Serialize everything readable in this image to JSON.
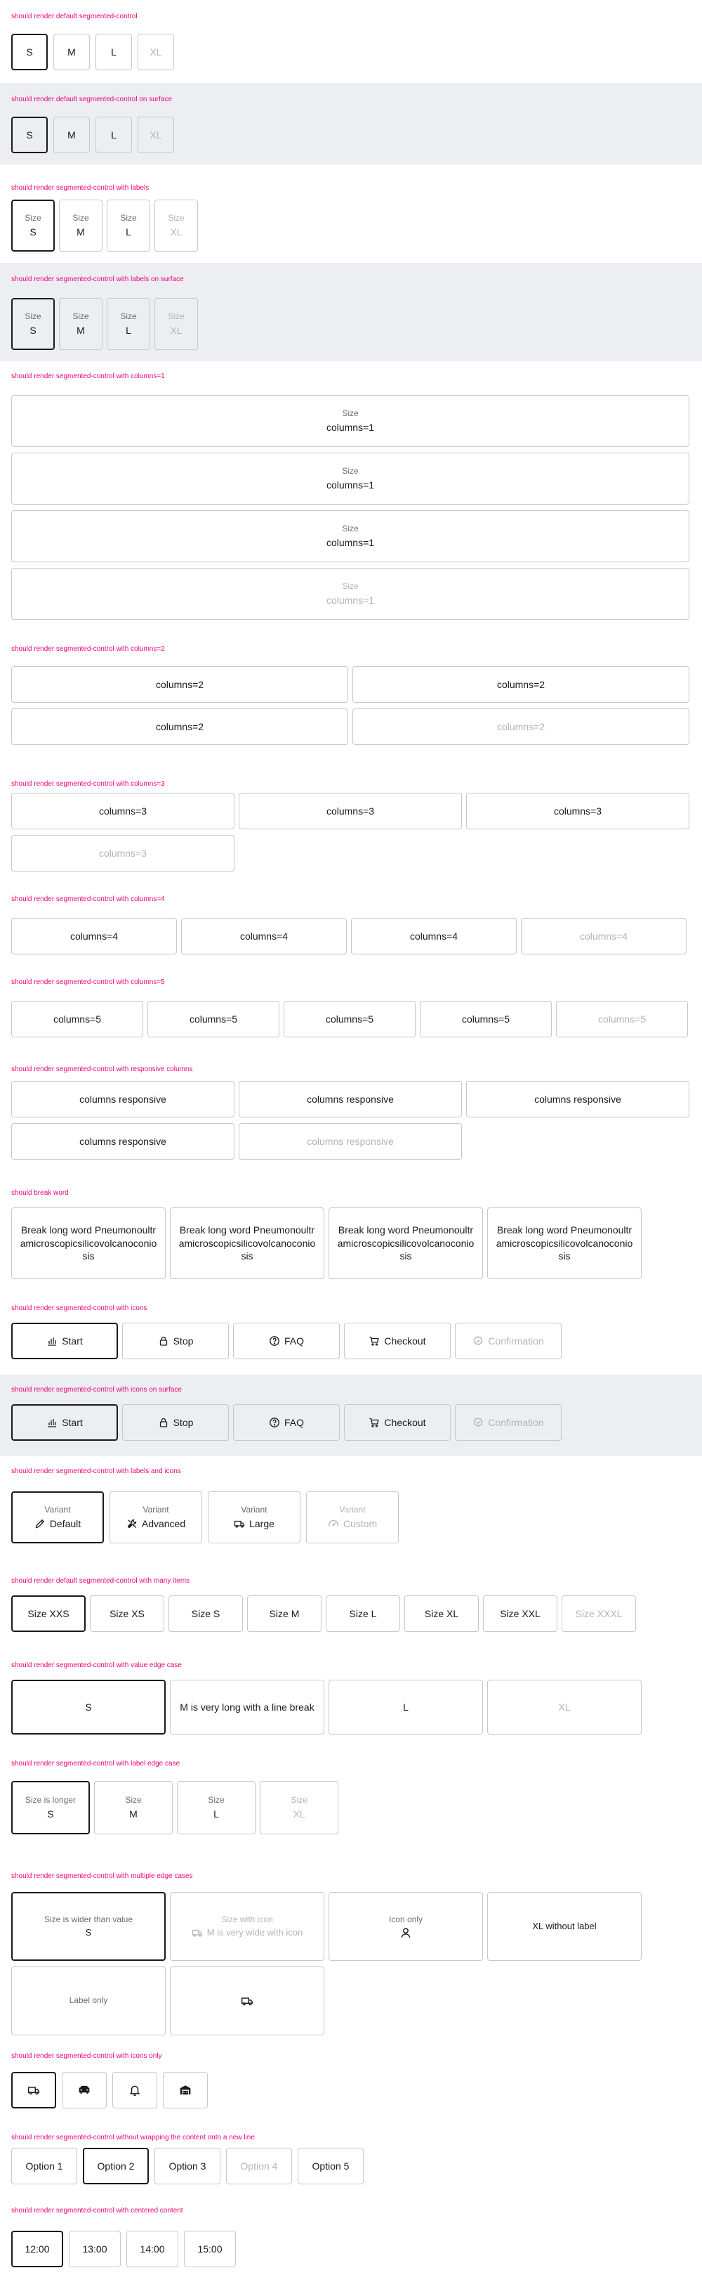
{
  "sections": [
    {
      "caption": "should render default segmented-control",
      "items": [
        "S",
        "M",
        "L",
        "XL"
      ]
    },
    {
      "caption": "should render default segmented-control on surface",
      "items": [
        "S",
        "M",
        "L",
        "XL"
      ]
    },
    {
      "caption": "should render segmented-control with labels",
      "label": "Size",
      "items": [
        "S",
        "M",
        "L",
        "XL"
      ]
    },
    {
      "caption": "should render segmented-control with labels on surface",
      "label": "Size",
      "items": [
        "S",
        "M",
        "L",
        "XL"
      ]
    },
    {
      "caption": "should render segmented-control with columns=1",
      "label": "Size",
      "value": "columns=1"
    },
    {
      "caption": "should render segmented-control with columns=2",
      "value": "columns=2"
    },
    {
      "caption": "should render segmented-control with columns=3",
      "value": "columns=3"
    },
    {
      "caption": "should render segmented-control with columns=4",
      "value": "columns=4"
    },
    {
      "caption": "should render segmented-control with columns=5",
      "value": "columns=5"
    },
    {
      "caption": "should render segmented-control with responsive columns",
      "value": "columns responsive"
    },
    {
      "caption": "should break word",
      "value": "Break long word Pneumonoultramicroscopicsilicovolcanoconiosis"
    },
    {
      "caption": "should render segmented-control with icons",
      "items": [
        "Start",
        "Stop",
        "FAQ",
        "Checkout",
        "Confirmation"
      ]
    },
    {
      "caption": "should render segmented-control with icons on surface",
      "items": [
        "Start",
        "Stop",
        "FAQ",
        "Checkout",
        "Confirmation"
      ]
    },
    {
      "caption": "should render segmented-control with labels and icons",
      "label": "Variant",
      "items": [
        "Default",
        "Advanced",
        "Large",
        "Custom"
      ]
    },
    {
      "caption": "should render default segmented-control with many items",
      "items": [
        "Size XXS",
        "Size XS",
        "Size S",
        "Size M",
        "Size L",
        "Size XL",
        "Size XXL",
        "Size XXXL"
      ]
    },
    {
      "caption": "should render segmented-control with value edge case",
      "items": [
        "S",
        "M is very long with a line break",
        "L",
        "XL"
      ]
    },
    {
      "caption": "should render segmented-control with label edge case",
      "labels": [
        "Size is longer",
        "Size",
        "Size",
        "Size"
      ],
      "items": [
        "S",
        "M",
        "L",
        "XL"
      ]
    },
    {
      "caption": "should render segmented-control with multiple edge cases",
      "items": [
        {
          "label": "Size is wider than value",
          "value": "S"
        },
        {
          "label": "Size with icon",
          "value": "M is very wide with icon"
        },
        {
          "label": "Icon only",
          "value": ""
        },
        {
          "label": "",
          "value": "XL without label"
        },
        {
          "label": "Label only",
          "value": ""
        },
        {
          "label": "",
          "value": ""
        }
      ]
    },
    {
      "caption": "should render segmented-control with icons only"
    },
    {
      "caption": "should render segmented-control without wrapping the content onto a new line",
      "items": [
        "Option 1",
        "Option 2",
        "Option 3",
        "Option 4",
        "Option 5"
      ]
    },
    {
      "caption": "should render segmented-control with centered content",
      "items": [
        "12:00",
        "13:00",
        "14:00",
        "15:00"
      ]
    }
  ],
  "icons": {
    "start": "chart-bars-icon",
    "stop": "lock-icon",
    "faq": "question-circle-icon",
    "checkout": "cart-icon",
    "confirmation": "badge-check-icon",
    "default": "pencil-icon",
    "advanced": "wrench-screwdriver-icon",
    "large": "truck-icon",
    "custom": "gauge-icon",
    "icon_only": "user-icon",
    "truck": "truck-icon",
    "car": "car-icon",
    "bell": "bell-icon",
    "garage": "garage-icon"
  },
  "colors": {
    "caption": "#e8067a",
    "surface": "#edeef1",
    "selected_border": "#1a1a1a",
    "disabled_text": "#b4b4b8"
  }
}
